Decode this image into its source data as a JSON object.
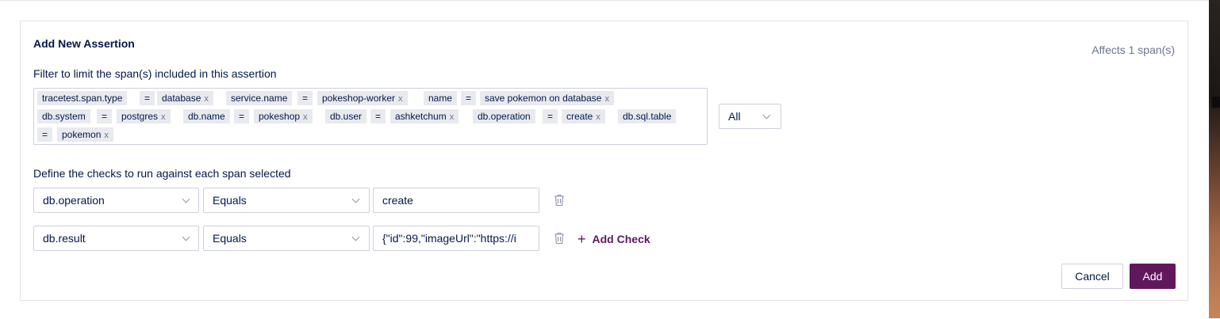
{
  "form": {
    "title": "Add New Assertion",
    "affects": "Affects 1 span(s)",
    "filter_label": "Filter to limit the span(s) included in this assertion",
    "filter_tags": [
      {
        "key": "tracetest.span.type",
        "op": "=",
        "value": "database"
      },
      {
        "key": "service.name",
        "op": "=",
        "value": "pokeshop-worker"
      },
      {
        "key": "name",
        "op": "=",
        "value": "save pokemon on database"
      },
      {
        "key": "db.system",
        "op": "=",
        "value": "postgres"
      },
      {
        "key": "db.name",
        "op": "=",
        "value": "pokeshop"
      },
      {
        "key": "db.user",
        "op": "=",
        "value": "ashketchum"
      },
      {
        "key": "db.operation",
        "op": "=",
        "value": "create"
      },
      {
        "key": "db.sql.table",
        "op": "=",
        "value": "pokemon"
      }
    ],
    "remove_glyph": "x",
    "match_select": "All",
    "checks_label": "Define the checks to run against each span selected",
    "checks": [
      {
        "attribute": "db.operation",
        "comparator": "Equals",
        "value": "create"
      },
      {
        "attribute": "db.result",
        "comparator": "Equals",
        "value": "{\"id\":99,\"imageUrl\":\"https://i"
      }
    ],
    "add_check_label": "Add Check",
    "add_check_icon": "plus-icon",
    "delete_icon": "trash-icon",
    "cancel_label": "Cancel",
    "add_label": "Add"
  },
  "colors": {
    "accent": "#61175e",
    "text": "#031849",
    "muted": "#687492",
    "tag_bg": "#e8eaef",
    "border": "#cdd1dc"
  }
}
